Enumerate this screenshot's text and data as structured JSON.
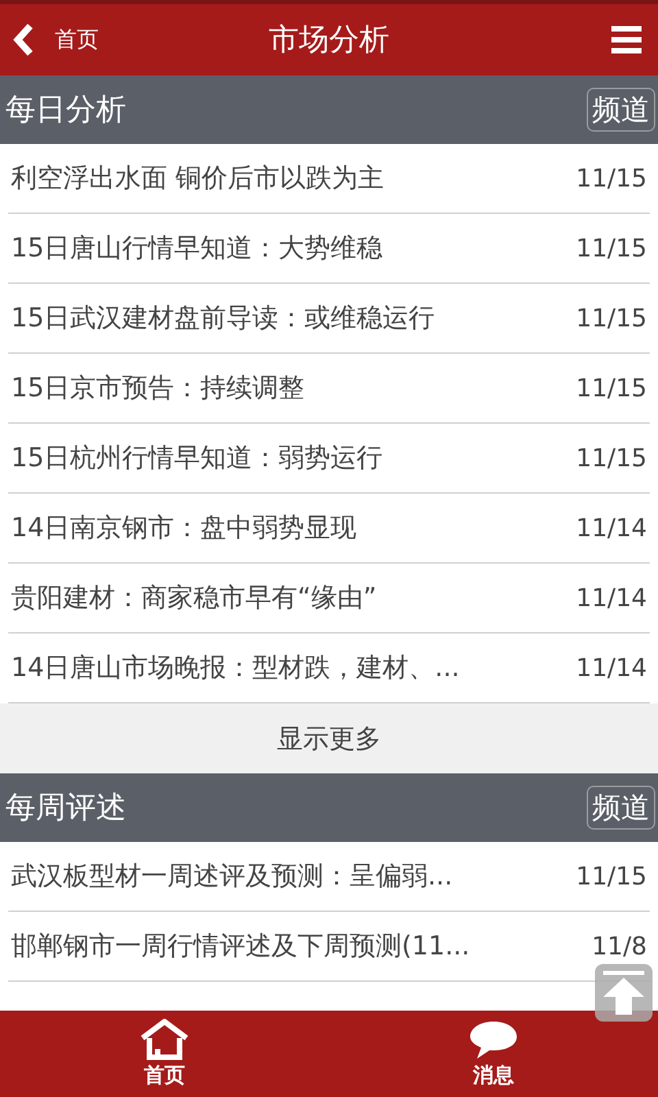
{
  "header": {
    "back_label": "首页",
    "title": "市场分析"
  },
  "sections": [
    {
      "title": "每日分析",
      "channel_button": "频道",
      "rows": [
        {
          "title": "利空浮出水面 铜价后市以跌为主",
          "date": "11/15"
        },
        {
          "title": "15日唐山行情早知道：大势维稳",
          "date": "11/15"
        },
        {
          "title": "15日武汉建材盘前导读：或维稳运行",
          "date": "11/15"
        },
        {
          "title": "15日京市预告：持续调整",
          "date": "11/15"
        },
        {
          "title": "15日杭州行情早知道：弱势运行",
          "date": "11/15"
        },
        {
          "title": "14日南京钢市：盘中弱势显现",
          "date": "11/14"
        },
        {
          "title": "贵阳建材：商家稳市早有“缘由”",
          "date": "11/14"
        },
        {
          "title": "14日唐山市场晚报：型材跌，建材、...",
          "date": "11/14"
        }
      ],
      "more": "显示更多"
    },
    {
      "title": "每周评述",
      "channel_button": "频道",
      "rows": [
        {
          "title": "武汉板型材一周述评及预测：呈偏弱...",
          "date": "11/15"
        },
        {
          "title": "邯郸钢市一周行情评述及下周预测(11...",
          "date": "11/8"
        }
      ]
    }
  ],
  "tab_bar": [
    {
      "kind": "home",
      "label": "首页"
    },
    {
      "kind": "message",
      "label": "消息"
    }
  ]
}
